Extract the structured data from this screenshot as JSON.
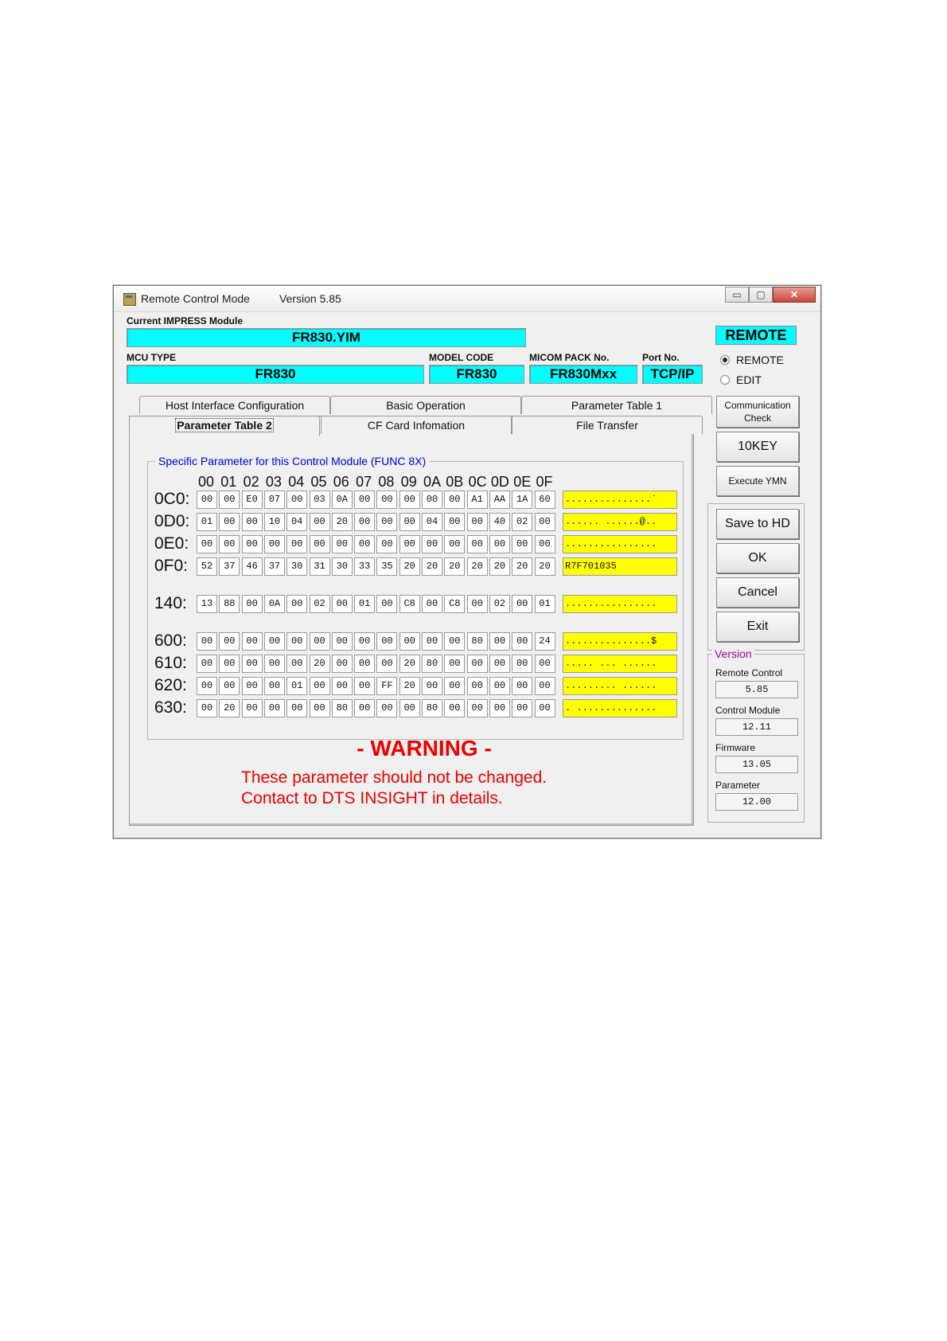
{
  "window": {
    "title": "Remote Control Mode",
    "version_label": "Version  5.85",
    "minimize": "▭",
    "maximize": "▢",
    "close": "✕"
  },
  "module": {
    "current_label": "Current IMPRESS Module",
    "current_value": "FR830.YIM",
    "mcu_label": "MCU TYPE",
    "mcu_value": "FR830",
    "model_label": "MODEL CODE",
    "model_value": "FR830",
    "micom_label": "MICOM PACK No.",
    "micom_value": "FR830Mxx",
    "port_label": "Port No.",
    "port_value": "TCP/IP"
  },
  "mode": {
    "badge": "REMOTE",
    "remote_label": "REMOTE",
    "edit_label": "EDIT"
  },
  "tabs": {
    "row1": [
      "Host Interface Configuration",
      "Basic Operation",
      "Parameter Table 1"
    ],
    "row2": [
      "Parameter Table 2",
      "CF Card Infomation",
      "File Transfer"
    ],
    "active": "Parameter Table 2"
  },
  "group_title": "Specific Parameter for this Control Module (FUNC 8X)",
  "col_headers": [
    "00",
    "01",
    "02",
    "03",
    "04",
    "05",
    "06",
    "07",
    "08",
    "09",
    "0A",
    "0B",
    "0C",
    "0D",
    "0E",
    "0F"
  ],
  "rows": [
    {
      "addr": "0C0:",
      "cells": [
        "00",
        "00",
        "E0",
        "07",
        "00",
        "03",
        "0A",
        "00",
        "00",
        "00",
        "00",
        "00",
        "A1",
        "AA",
        "1A",
        "60"
      ],
      "ascii": "...............`"
    },
    {
      "addr": "0D0:",
      "cells": [
        "01",
        "00",
        "00",
        "10",
        "04",
        "00",
        "20",
        "00",
        "00",
        "00",
        "04",
        "00",
        "00",
        "40",
        "02",
        "00"
      ],
      "ascii": "...... ......@.."
    },
    {
      "addr": "0E0:",
      "cells": [
        "00",
        "00",
        "00",
        "00",
        "00",
        "00",
        "00",
        "00",
        "00",
        "00",
        "00",
        "00",
        "00",
        "00",
        "00",
        "00"
      ],
      "ascii": "................"
    },
    {
      "addr": "0F0:",
      "cells": [
        "52",
        "37",
        "46",
        "37",
        "30",
        "31",
        "30",
        "33",
        "35",
        "20",
        "20",
        "20",
        "20",
        "20",
        "20",
        "20"
      ],
      "ascii": "R7F701035"
    },
    {
      "addr": "140:",
      "cells": [
        "13",
        "88",
        "00",
        "0A",
        "00",
        "02",
        "00",
        "01",
        "00",
        "C8",
        "00",
        "C8",
        "00",
        "02",
        "00",
        "01"
      ],
      "ascii": "................"
    },
    {
      "addr": "600:",
      "cells": [
        "00",
        "00",
        "00",
        "00",
        "00",
        "00",
        "00",
        "00",
        "00",
        "00",
        "00",
        "00",
        "80",
        "00",
        "00",
        "24"
      ],
      "ascii": "...............$"
    },
    {
      "addr": "610:",
      "cells": [
        "00",
        "00",
        "00",
        "00",
        "00",
        "20",
        "00",
        "00",
        "00",
        "20",
        "80",
        "00",
        "00",
        "00",
        "00",
        "00"
      ],
      "ascii": "..... ... ......"
    },
    {
      "addr": "620:",
      "cells": [
        "00",
        "00",
        "00",
        "00",
        "01",
        "00",
        "00",
        "00",
        "FF",
        "20",
        "00",
        "00",
        "00",
        "00",
        "00",
        "00"
      ],
      "ascii": "......... ......"
    },
    {
      "addr": "630:",
      "cells": [
        "00",
        "20",
        "00",
        "00",
        "00",
        "00",
        "80",
        "00",
        "00",
        "00",
        "80",
        "00",
        "00",
        "00",
        "00",
        "00"
      ],
      "ascii": ". .............."
    }
  ],
  "warning": {
    "title": "- WARNING -",
    "line1": "These parameter should not be changed.",
    "line2": "Contact to DTS INSIGHT in details."
  },
  "buttons": {
    "comm_check": "Communication Check",
    "tenkey": "10KEY",
    "execute": "Execute YMN",
    "save": "Save to HD",
    "ok": "OK",
    "cancel": "Cancel",
    "exit": "Exit"
  },
  "versions": {
    "title": "Version",
    "remote_label": "Remote Control",
    "remote_value": "5.85",
    "module_label": "Control Module",
    "module_value": "12.11",
    "firmware_label": "Firmware",
    "firmware_value": "13.05",
    "parameter_label": "Parameter",
    "parameter_value": "12.00"
  },
  "colors": {
    "accent_cyan": "#00ffff",
    "ascii_yellow": "#ffff00",
    "warning_red": "#ee0000",
    "group_blue": "#0000e0",
    "version_purple": "#a000a0"
  }
}
